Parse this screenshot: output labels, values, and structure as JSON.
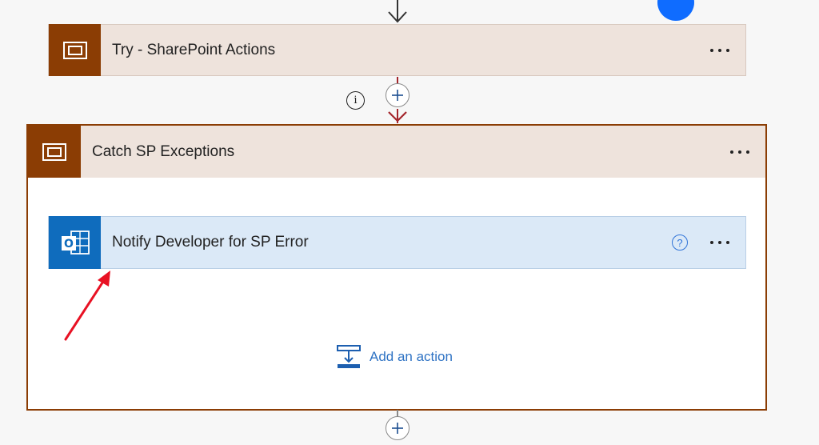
{
  "flow": {
    "try_scope": {
      "title": "Try - SharePoint Actions",
      "icon": "scope-icon",
      "accent": "#8b3d04"
    },
    "catch_scope": {
      "title": "Catch SP Exceptions",
      "icon": "scope-icon",
      "accent": "#8b3d04"
    },
    "notify_action": {
      "title": "Notify Developer for SP Error",
      "icon": "outlook-icon",
      "accent": "#0f6cbd",
      "help_icon": "help-icon"
    },
    "add_action": {
      "label": "Add an action",
      "icon": "add-action-icon"
    },
    "add_step_icon": "plus-icon",
    "info_icon": "info-icon",
    "more_icon": "more-options-icon"
  },
  "colors": {
    "scope_header_bg": "#eee3dc",
    "action_bg": "#dbe9f7",
    "error_connector": "#a4262c",
    "annotation_arrow": "#e81123",
    "link": "#2f73c4"
  }
}
